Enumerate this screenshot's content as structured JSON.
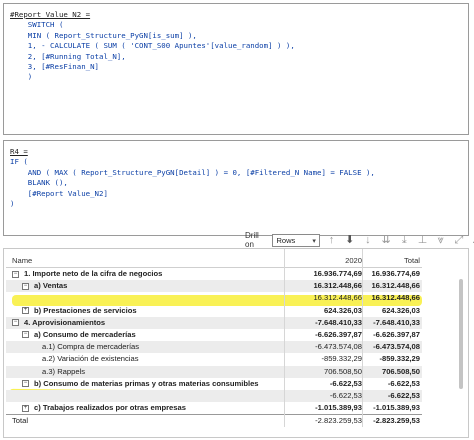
{
  "measure1": {
    "lines": [
      "#Report Value_N2 =",
      "    SWITCH (",
      "    MIN ( Report_Structure_PyGN[is_sum] ),",
      "    1, - CALCULATE ( SUM ( 'CONT_S00 Apuntes'[value_random] ) ),",
      "    2, [#Running Total_N],",
      "    3, [#ResFinan_N]",
      "    )"
    ]
  },
  "measure2": {
    "lines": [
      "R4 =",
      "IF (",
      "    AND ( MAX ( Report_Structure_PyGN[Detail] ) = 0, [#Filtered_N Name] = FALSE ),",
      "    BLANK (),",
      "    [#Report Value_N2]",
      ")"
    ]
  },
  "toolbar": {
    "drill_label": "Drill on",
    "drill_value": "Rows",
    "icons": [
      "drill-up-icon",
      "drill-down-circle-icon",
      "next-level-icon",
      "expand-all-icon",
      "expand-down-icon",
      "pin-icon",
      "filter-icon",
      "focus-mode-icon",
      "more-options-icon"
    ]
  },
  "matrix": {
    "headers": {
      "name": "Name",
      "col2020": "2020",
      "total": "Total"
    },
    "rows": [
      {
        "label": "1. Importe neto de la cifra de negocios",
        "v2020": "16.936.774,69",
        "total": "16.936.774,69",
        "bold": true,
        "expander": "⊟",
        "indent": 0
      },
      {
        "label": "a) Ventas",
        "v2020": "16.312.448,66",
        "total": "16.312.448,66",
        "bold": true,
        "expander": "⊟",
        "indent": 1,
        "shade": true
      },
      {
        "label": "",
        "v2020": "16.312.448,66",
        "total": "16.312.448,66",
        "bold": false,
        "expander": "",
        "indent": 2,
        "total_bold": true
      },
      {
        "label": "b) Prestaciones de servicios",
        "v2020": "624.326,03",
        "total": "624.326,03",
        "bold": true,
        "expander": "⊞",
        "indent": 1
      },
      {
        "label": "4. Aprovisionamientos",
        "v2020": "-7.648.410,33",
        "total": "-7.648.410,33",
        "bold": true,
        "expander": "⊟",
        "indent": 0,
        "shade": true
      },
      {
        "label": "a) Consumo de mercaderías",
        "v2020": "-6.626.397,87",
        "total": "-6.626.397,87",
        "bold": true,
        "expander": "⊟",
        "indent": 1
      },
      {
        "label": "a.1) Compra de mercaderías",
        "v2020": "-6.473.574,08",
        "total": "-6.473.574,08",
        "bold": false,
        "expander": "",
        "indent": 2,
        "total_bold": true,
        "shade": true
      },
      {
        "label": "a.2) Variación de existencias",
        "v2020": "-859.332,29",
        "total": "-859.332,29",
        "bold": false,
        "expander": "",
        "indent": 2,
        "total_bold": true
      },
      {
        "label": "a.3) Rappels",
        "v2020": "706.508,50",
        "total": "706.508,50",
        "bold": false,
        "expander": "",
        "indent": 2,
        "total_bold": true,
        "shade": true
      },
      {
        "label": "b) Consumo de materias primas y otras materias consumibles",
        "v2020": "-6.622,53",
        "total": "-6.622,53",
        "bold": true,
        "expander": "⊟",
        "indent": 1
      },
      {
        "label": "",
        "v2020": "-6.622,53",
        "total": "-6.622,53",
        "bold": false,
        "expander": "",
        "indent": 2,
        "total_bold": true,
        "shade": true
      },
      {
        "label": "c) Trabajos realizados por otras empresas",
        "v2020": "-1.015.389,93",
        "total": "-1.015.389,93",
        "bold": true,
        "expander": "⊞",
        "indent": 1
      },
      {
        "label": "Total",
        "v2020": "-2.823.259,53",
        "total": "-2.823.259,53",
        "bold": false,
        "expander": "",
        "indent": 0,
        "total_bold": true,
        "total_row": true
      }
    ]
  },
  "colors": {
    "highlight": "#f7ee2a",
    "code_text": "#0b3fa6"
  }
}
